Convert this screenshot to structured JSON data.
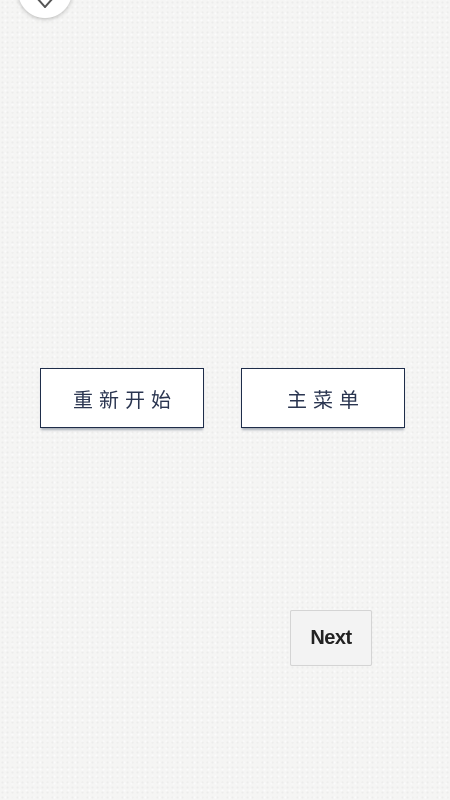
{
  "top_controls": {
    "close_icon": "close-icon"
  },
  "menu": {
    "restart_label": "重新开始",
    "main_menu_label": "主菜单"
  },
  "navigation": {
    "next_label": "Next"
  },
  "colors": {
    "button_border": "#1e2d4a",
    "button_text": "#2a3550",
    "background": "#f5f5f4"
  }
}
